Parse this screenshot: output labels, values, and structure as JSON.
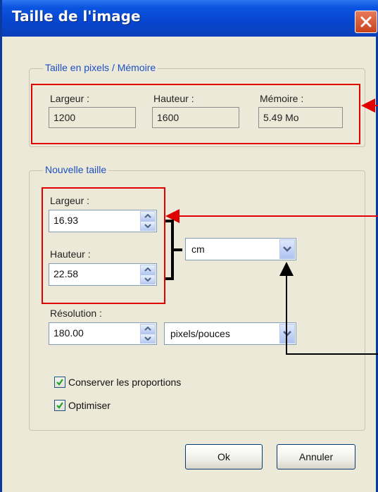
{
  "dialog": {
    "title": "Taille de l'image",
    "close_symbol": "✕"
  },
  "pixel_group": {
    "legend": "Taille en pixels / Mémoire",
    "width_label": "Largeur :",
    "width_value": "1200",
    "height_label": "Hauteur :",
    "height_value": "1600",
    "memory_label": "Mémoire :",
    "memory_value": "5.49 Mo"
  },
  "new_size_group": {
    "legend": "Nouvelle taille",
    "width_label": "Largeur :",
    "width_value": "16.93",
    "height_label": "Hauteur :",
    "height_value": "22.58",
    "unit_selected": "cm",
    "resolution_label": "Résolution :",
    "resolution_value": "180.00",
    "resolution_unit": "pixels/pouces",
    "keep_proportions_label": "Conserver les proportions",
    "keep_proportions_checked": true,
    "optimize_label": "Optimiser",
    "optimize_checked": true
  },
  "buttons": {
    "ok": "Ok",
    "cancel": "Annuler"
  },
  "colors": {
    "annotation_red": "#e00000",
    "annotation_black": "#000000",
    "group_legend_blue": "#1c4fc4",
    "titlebar_blue": "#0b55e0"
  }
}
